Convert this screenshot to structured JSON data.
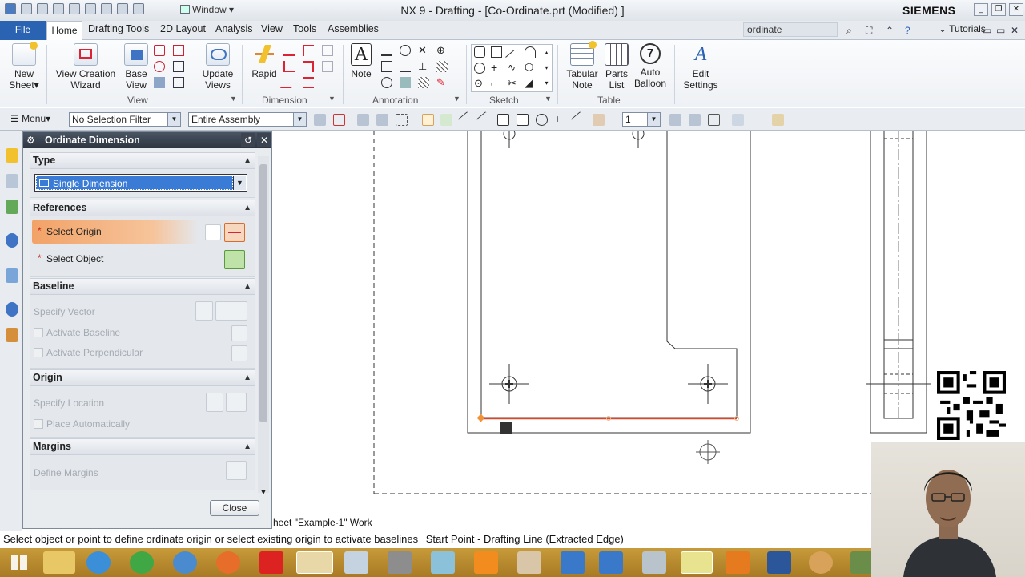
{
  "window": {
    "title": "NX 9 - Drafting - [Co-Ordinate.prt (Modified) ]",
    "window_menu": "Window",
    "brand": "SIEMENS"
  },
  "menubar": {
    "file": "File",
    "tabs": [
      "Home",
      "Drafting Tools",
      "2D Layout",
      "Analysis",
      "View",
      "Tools",
      "Assemblies"
    ],
    "search_value": "ordinate",
    "tutorials": "Tutorials"
  },
  "ribbon": {
    "new_sheet": [
      "New",
      "Sheet"
    ],
    "view_creation_wizard": [
      "View Creation",
      "Wizard"
    ],
    "base_view": [
      "Base",
      "View"
    ],
    "update_views": [
      "Update",
      "Views"
    ],
    "rapid": "Rapid",
    "note": "Note",
    "tabular_note": [
      "Tabular",
      "Note"
    ],
    "parts_list": [
      "Parts",
      "List"
    ],
    "auto_balloon": [
      "Auto",
      "Balloon"
    ],
    "edit_settings": [
      "Edit",
      "Settings"
    ],
    "groups": {
      "view": "View",
      "dimension": "Dimension",
      "annotation": "Annotation",
      "sketch": "Sketch",
      "table": "Table"
    }
  },
  "toolbar": {
    "menu": "Menu",
    "selection_filter": "No Selection Filter",
    "scope": "Entire Assembly",
    "layer": "1"
  },
  "dialog": {
    "title": "Ordinate Dimension",
    "type_section": "Type",
    "type_value": "Single Dimension",
    "references_section": "References",
    "select_origin": "Select Origin",
    "select_object": "Select Object",
    "baseline_section": "Baseline",
    "specify_vector": "Specify Vector",
    "activate_baseline": "Activate Baseline",
    "activate_perpendicular": "Activate Perpendicular",
    "origin_section": "Origin",
    "specify_location": "Specify Location",
    "place_automatically": "Place Automatically",
    "margins_section": "Margins",
    "define_margins": "Define Margins",
    "close": "Close"
  },
  "canvas": {
    "sheet_label": "heet \"Example-1\" Work"
  },
  "status": {
    "prompt": "Select object or point to define ordinate origin or select existing origin to activate baselines",
    "info": "Start Point - Drafting Line (Extracted Edge)"
  },
  "colors": {
    "accent_blue": "#2b63b3",
    "highlight_orange": "#f2a267",
    "dim_red": "#d9472b"
  }
}
